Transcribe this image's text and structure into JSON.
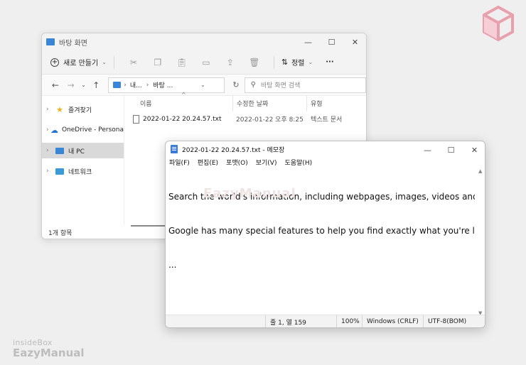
{
  "brand": {
    "small": "insideBox",
    "big": "EazyManual",
    "notepad_watermark": "EazyManual"
  },
  "explorer": {
    "title": "바탕 화면",
    "toolbar": {
      "new_label": "새로 만들기",
      "sort_label": "정렬",
      "more_label": "···"
    },
    "address": {
      "crumbs": [
        "내...",
        "바탕 ..."
      ],
      "search_placeholder": "바탕 화면 검색"
    },
    "sidebar": {
      "items": [
        {
          "label": "즐겨찾기"
        },
        {
          "label": "OneDrive - Persona"
        },
        {
          "label": "내 PC"
        },
        {
          "label": "네트워크"
        }
      ]
    },
    "columns": [
      "이름",
      "수정한 날짜",
      "유형"
    ],
    "files": [
      {
        "name": "2022-01-22 20.24.57.txt",
        "modified": "2022-01-22 오후 8:25",
        "type": "텍스트 문서"
      }
    ],
    "status": "1개 항목"
  },
  "notepad": {
    "title": "2022-01-22 20.24.57.txt - 메모장",
    "menu": [
      "파일(F)",
      "편집(E)",
      "포맷(O)",
      "보기(V)",
      "도움말(H)"
    ],
    "lines": [
      "Search the world's information, including webpages, images, videos and more.",
      "Google has many special features to help you find exactly what you're looking",
      "..."
    ],
    "status": {
      "position": "줄 1, 열 159",
      "zoom": "100%",
      "eol": "Windows (CRLF)",
      "encoding": "UTF-8(BOM)"
    }
  },
  "colors": {
    "accent": "#3a7bd5",
    "onedrive": "#1e73d6",
    "favorites": "#f2b01e",
    "logo": "#e8a0ad"
  }
}
